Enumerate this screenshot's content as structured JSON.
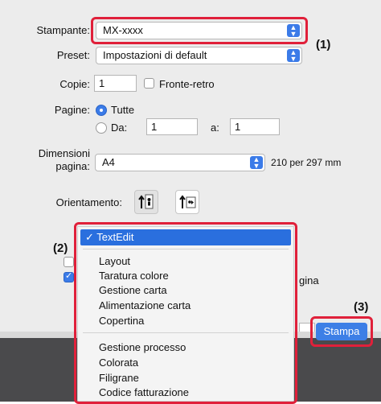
{
  "form": {
    "printer_label": "Stampante:",
    "printer_value": "MX-xxxx",
    "preset_label": "Preset:",
    "preset_value": "Impostazioni di default",
    "copies_label": "Copie:",
    "copies_value": "1",
    "duplex_label": "Fronte-retro",
    "pages_label": "Pagine:",
    "pages_all": "Tutte",
    "pages_from": "Da:",
    "pages_from_value": "1",
    "pages_to": "a:",
    "pages_to_value": "1",
    "size_label_1": "Dimensioni",
    "size_label_2": "pagina:",
    "size_value": "A4",
    "size_desc": "210 per 297 mm",
    "orientation_label": "Orientamento:",
    "partial_text": "gina",
    "print_button": "Stampa"
  },
  "menu": {
    "selected": "✓ TextEdit",
    "group1": [
      "Layout",
      "Taratura colore",
      "Gestione carta",
      "Alimentazione carta",
      "Copertina"
    ],
    "group2": [
      "Gestione processo",
      "Colorata",
      "Filigrane",
      "Codice fatturazione"
    ]
  },
  "callouts": {
    "c1": "(1)",
    "c2": "(2)",
    "c3": "(3)"
  },
  "colors": {
    "accent": "#3b7be8",
    "callout_red": "#e0203a"
  }
}
